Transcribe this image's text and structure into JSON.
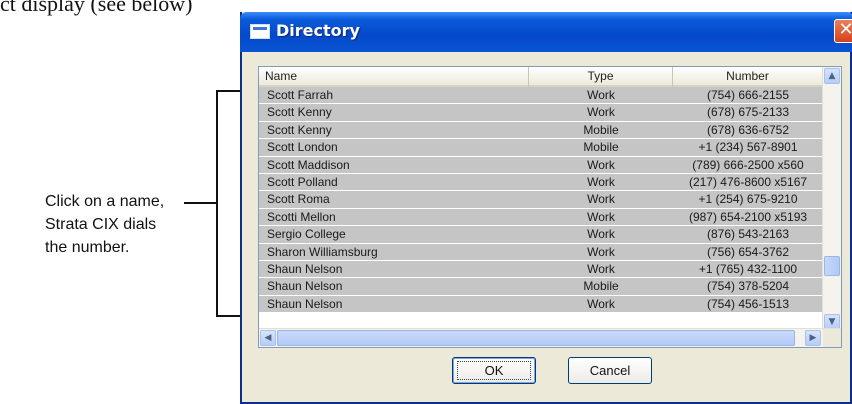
{
  "page": {
    "top_fragment": "ct display (see below)",
    "callout_lines": [
      "Click on a name,",
      "Strata CIX dials",
      "the number."
    ]
  },
  "window": {
    "title": "Directory",
    "close_glyph": "✕",
    "title_icon": "window-icon"
  },
  "list": {
    "columns": [
      "Name",
      "Type",
      "Number"
    ],
    "rows": [
      {
        "name": "Scott Farrah",
        "type": "Work",
        "number": "(754) 666-2155"
      },
      {
        "name": "Scott Kenny",
        "type": "Work",
        "number": "(678) 675-2133"
      },
      {
        "name": "Scott Kenny",
        "type": "Mobile",
        "number": "(678) 636-6752"
      },
      {
        "name": "Scott London",
        "type": "Mobile",
        "number": "+1 (234) 567-8901"
      },
      {
        "name": "Scott Maddison",
        "type": "Work",
        "number": "(789) 666-2500 x560"
      },
      {
        "name": "Scott Polland",
        "type": "Work",
        "number": "(217) 476-8600 x5167"
      },
      {
        "name": "Scott Roma",
        "type": "Work",
        "number": "+1 (254) 675-9210"
      },
      {
        "name": "Scotti Mellon",
        "type": "Work",
        "number": "(987) 654-2100 x5193"
      },
      {
        "name": "Sergio College",
        "type": "Work",
        "number": "(876) 543-2163"
      },
      {
        "name": "Sharon Williamsburg",
        "type": "Work",
        "number": "(756) 654-3762"
      },
      {
        "name": "Shaun Nelson",
        "type": "Work",
        "number": "+1 (765) 432-1100"
      },
      {
        "name": "Shaun Nelson",
        "type": "Mobile",
        "number": "(754) 378-5204"
      },
      {
        "name": "Shaun Nelson",
        "type": "Work",
        "number": "(754) 456-1513"
      }
    ],
    "row_highlight_color": "#c5c5c5"
  },
  "buttons": {
    "ok": "OK",
    "cancel": "Cancel"
  },
  "colors": {
    "titlebar": "#0a55d4",
    "close": "#d9401e",
    "dialog_bg": "#ece9d8"
  }
}
